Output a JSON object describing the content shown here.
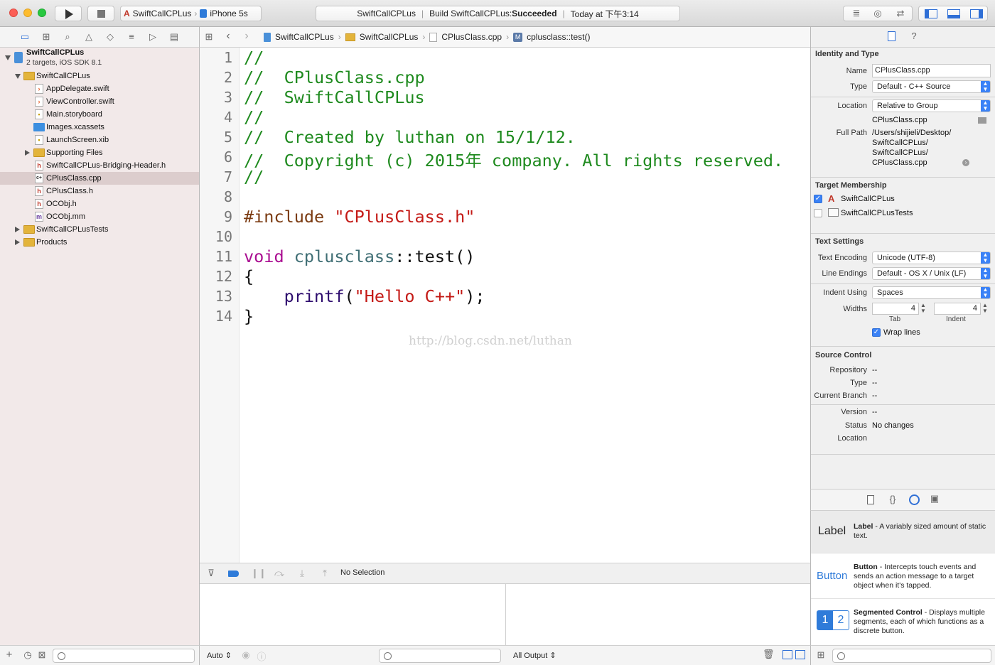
{
  "toolbar": {
    "scheme_target": "SwiftCallCPLus",
    "scheme_device": "iPhone 5s",
    "status_project": "SwiftCallCPLus",
    "status_build_prefix": "Build SwiftCallCPLus: ",
    "status_build_result": "Succeeded",
    "status_time": "Today at 下午3:14"
  },
  "navigator": {
    "project_name": "SwiftCallCPLus",
    "project_sub": "2 targets, iOS SDK 8.1",
    "items": [
      {
        "label": "SwiftCallCPLus",
        "kind": "folder"
      },
      {
        "label": "AppDelegate.swift",
        "kind": "swift"
      },
      {
        "label": "ViewController.swift",
        "kind": "swift"
      },
      {
        "label": "Main.storyboard",
        "kind": "storyboard"
      },
      {
        "label": "Images.xcassets",
        "kind": "assets"
      },
      {
        "label": "LaunchScreen.xib",
        "kind": "xib"
      },
      {
        "label": "Supporting Files",
        "kind": "folder"
      },
      {
        "label": "SwiftCallCPLus-Bridging-Header.h",
        "kind": "h"
      },
      {
        "label": "CPlusClass.cpp",
        "kind": "cpp"
      },
      {
        "label": "CPlusClass.h",
        "kind": "h"
      },
      {
        "label": "OCObj.h",
        "kind": "h"
      },
      {
        "label": "OCObj.mm",
        "kind": "m"
      },
      {
        "label": "SwiftCallCPLusTests",
        "kind": "folder"
      },
      {
        "label": "Products",
        "kind": "folder"
      }
    ]
  },
  "jumpbar": {
    "crumbs": [
      "SwiftCallCPLus",
      "SwiftCallCPLus",
      "CPlusClass.cpp",
      "cplusclass::test()"
    ]
  },
  "editor": {
    "line_numbers": [
      "1",
      "2",
      "3",
      "4",
      "5",
      "6",
      "7",
      "8",
      "9",
      "10",
      "11",
      "12",
      "13",
      "14"
    ],
    "lines": {
      "l1": "//",
      "l2": "//  CPlusClass.cpp",
      "l3": "//  SwiftCallCPLus",
      "l4": "//",
      "l5": "//  Created by luthan on 15/1/12.",
      "l6": "//  Copyright (c) 2015年 company. All rights reserved.",
      "l7": "//",
      "l9_directive": "#include ",
      "l9_path": "\"CPlusClass.h\"",
      "l11_keyword": "void",
      "l11_class": "cplusclass",
      "l11_rest": "::test()",
      "l12": "{",
      "l13_func": "printf",
      "l13_open": "(",
      "l13_string": "\"Hello C++\"",
      "l13_close": ");",
      "l14": "}"
    },
    "watermark": "http://blog.csdn.net/luthan"
  },
  "debug": {
    "selection": "No Selection",
    "auto_label": "Auto",
    "output_label": "All Output"
  },
  "inspector": {
    "identity_title": "Identity and Type",
    "name_label": "Name",
    "name_value": "CPlusClass.cpp",
    "type_label": "Type",
    "type_value": "Default - C++ Source",
    "location_label": "Location",
    "location_value": "Relative to Group",
    "location_file": "CPlusClass.cpp",
    "fullpath_label": "Full Path",
    "fullpath_lines": [
      "/Users/shijieli/Desktop/",
      "SwiftCallCPLus/",
      "SwiftCallCPLus/",
      "CPlusClass.cpp"
    ],
    "membership_title": "Target Membership",
    "targets": [
      {
        "label": "SwiftCallCPLus",
        "checked": true
      },
      {
        "label": "SwiftCallCPLusTests",
        "checked": false
      }
    ],
    "text_title": "Text Settings",
    "encoding_label": "Text Encoding",
    "encoding_value": "Unicode (UTF-8)",
    "endings_label": "Line Endings",
    "endings_value": "Default - OS X / Unix (LF)",
    "indent_label": "Indent Using",
    "indent_value": "Spaces",
    "widths_label": "Widths",
    "tab_width": "4",
    "indent_width": "4",
    "tab_caption": "Tab",
    "indent_caption": "Indent",
    "wrap_label": "Wrap lines",
    "sc_title": "Source Control",
    "repo_label": "Repository",
    "repo_value": "--",
    "sctype_label": "Type",
    "sctype_value": "--",
    "branch_label": "Current Branch",
    "branch_value": "--",
    "version_label": "Version",
    "version_value": "--",
    "status_label": "Status",
    "status_value": "No changes",
    "scloc_label": "Location"
  },
  "library": {
    "items": [
      {
        "preview": "Label",
        "name": "Label",
        "desc": " - A variably sized amount of static text."
      },
      {
        "preview": "Button",
        "name": "Button",
        "desc": " - Intercepts touch events and sends an action message to a target object when it's tapped."
      },
      {
        "preview_a": "1",
        "preview_b": "2",
        "name": "Segmented Control",
        "desc": " - Displays multiple segments, each of which functions as a discrete button."
      }
    ]
  },
  "colors": {
    "accent": "#3b82f6",
    "comment": "#1e8a1e",
    "string": "#c41a16",
    "keyword": "#aa0d91"
  }
}
